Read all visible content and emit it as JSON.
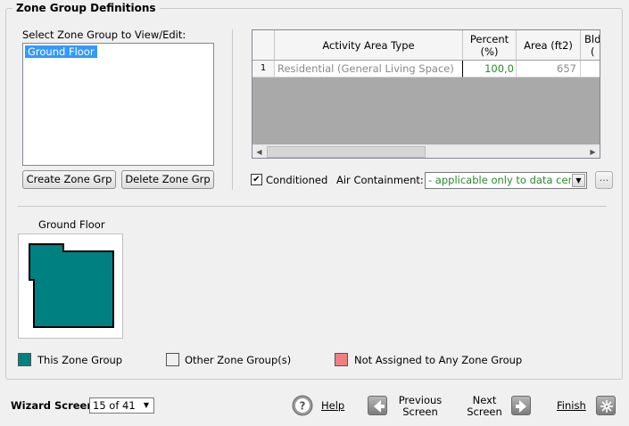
{
  "title": "Zone Group Definitions",
  "select_label": "Select Zone Group to View/Edit:",
  "zone_groups": [
    "Ground Floor"
  ],
  "buttons": {
    "create": "Create Zone Grp",
    "delete": "Delete Zone Grp"
  },
  "grid": {
    "headers": [
      "Activity Area Type",
      "Percent\n(%)",
      "Area (ft2)",
      "Bld\n("
    ],
    "rows": [
      {
        "num": "1",
        "type": "Residential (General Living Space)",
        "percent": "100,0",
        "area": "657"
      }
    ]
  },
  "conditioned": {
    "label": "Conditioned",
    "checked": true,
    "mark": "✔"
  },
  "air_containment": {
    "label": "Air Containment:",
    "value": "- applicable only to data cen"
  },
  "ellipsis": "...",
  "preview": {
    "label": "Ground Floor",
    "fill": "#008080"
  },
  "legend": [
    {
      "label": "This Zone Group",
      "color": "#008080"
    },
    {
      "label": "Other Zone Group(s)",
      "color": "#f0f0f0"
    },
    {
      "label": "Not Assigned to Any Zone Group",
      "color": "#f08080"
    }
  ],
  "footer": {
    "wizard_label": "Wizard Screen",
    "wizard_value": "15 of 41",
    "help": "Help",
    "previous_1": "Previous",
    "previous_2": "Screen",
    "next_1": "Next",
    "next_2": "Screen",
    "finish": "Finish"
  }
}
